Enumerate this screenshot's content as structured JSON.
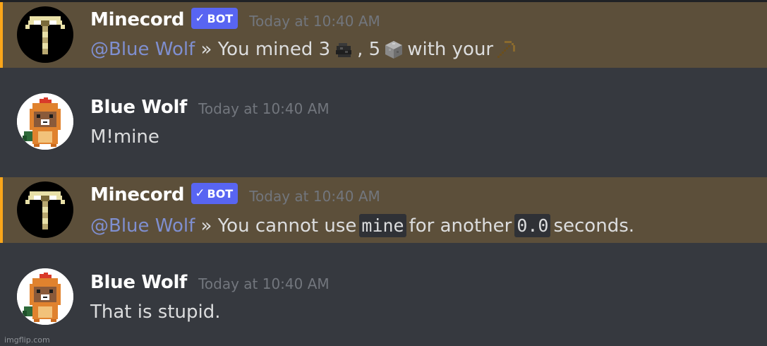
{
  "messages": [
    {
      "author": "Minecord",
      "bot_tag": "BOT",
      "timestamp": "Today at 10:40 AM",
      "mention": "@Blue Wolf",
      "separator": "»",
      "text_a": "You mined 3",
      "icon_a": "coal-icon",
      "text_b": ", 5",
      "icon_b": "stone-block-icon",
      "text_c": "with your",
      "icon_c": "wooden-pickaxe-icon"
    },
    {
      "author": "Blue Wolf",
      "timestamp": "Today at 10:40 AM",
      "text": "M!mine"
    },
    {
      "author": "Minecord",
      "bot_tag": "BOT",
      "timestamp": "Today at 10:40 AM",
      "mention": "@Blue Wolf",
      "separator": "»",
      "text_a": "You cannot use",
      "code_a": "mine",
      "text_b": "for another",
      "code_b": "0.0",
      "text_c": "seconds."
    },
    {
      "author": "Blue Wolf",
      "timestamp": "Today at 10:40 AM",
      "text": "That is stupid."
    }
  ],
  "watermark": "imgflip.com",
  "colors": {
    "background": "#36393f",
    "mention_background": "#5c4f3a",
    "mention_bar": "#faa61a",
    "bot_tag": "#5865f2",
    "mention_text": "#7f8fd0",
    "timestamp": "#72767d"
  }
}
